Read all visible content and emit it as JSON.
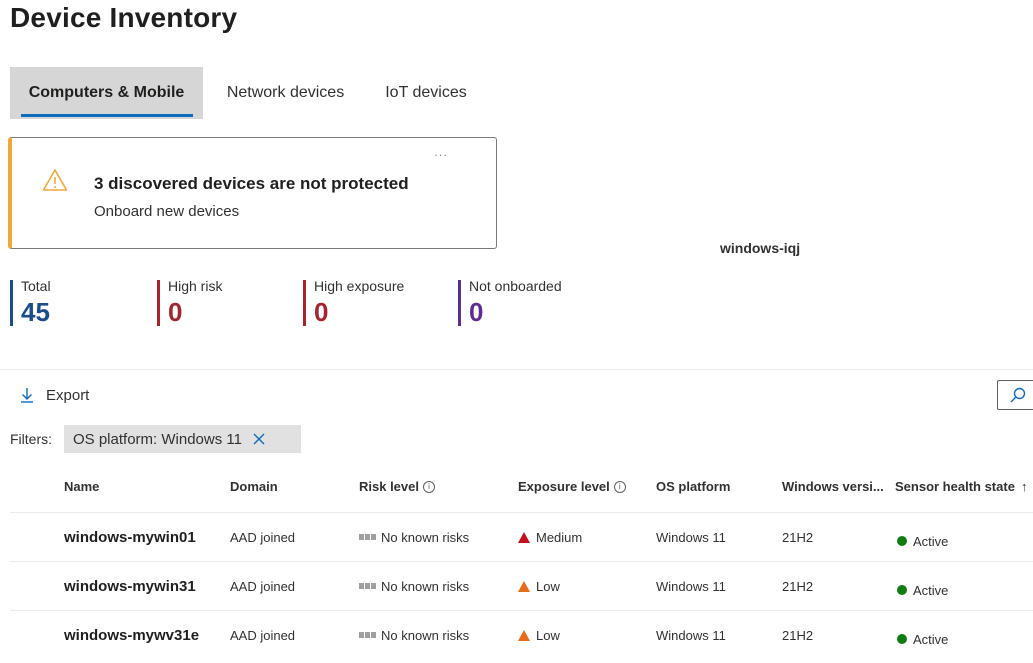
{
  "page": {
    "title": "Device Inventory"
  },
  "tabs": [
    {
      "label": "Computers & Mobile",
      "selected": true
    },
    {
      "label": "Network devices",
      "selected": false
    },
    {
      "label": "IoT devices",
      "selected": false
    }
  ],
  "alert": {
    "more": "...",
    "title": "3 discovered devices are not protected",
    "subtitle": "Onboard new devices",
    "accent_color": "#f2a73b"
  },
  "floating_device_name": "windows-iqj",
  "stats": [
    {
      "label": "Total",
      "value": "45",
      "color": "#1a4d8c"
    },
    {
      "label": "High risk",
      "value": "0",
      "color": "#a4262c"
    },
    {
      "label": "High exposure",
      "value": "0",
      "color": "#a4262c"
    },
    {
      "label": "Not onboarded",
      "value": "0",
      "color": "#5c2e91"
    }
  ],
  "toolbar": {
    "export_label": "Export",
    "search_icon": "search-icon"
  },
  "filters": {
    "label": "Filters:",
    "chips": [
      {
        "text": "OS platform: Windows 11"
      }
    ]
  },
  "table": {
    "columns": [
      "Name",
      "Domain",
      "Risk level",
      "Exposure level",
      "OS platform",
      "Windows versi...",
      "Sensor health state"
    ],
    "sort_indicator": "↑",
    "rows": [
      {
        "name": "windows-mywin01",
        "domain": "AAD joined",
        "risk": "No known risks",
        "exposure": "Medium",
        "exposure_color": "#c50f1f",
        "os": "Windows 11",
        "version": "21H2",
        "health": "Active"
      },
      {
        "name": "windows-mywin31",
        "domain": "AAD joined",
        "risk": "No known risks",
        "exposure": "Low",
        "exposure_color": "#e66c19",
        "os": "Windows 11",
        "version": "21H2",
        "health": "Active"
      },
      {
        "name": "windows-mywv31e",
        "domain": "AAD joined",
        "risk": "No known risks",
        "exposure": "Low",
        "exposure_color": "#e66c19",
        "os": "Windows 11",
        "version": "21H2",
        "health": "Active"
      }
    ]
  }
}
